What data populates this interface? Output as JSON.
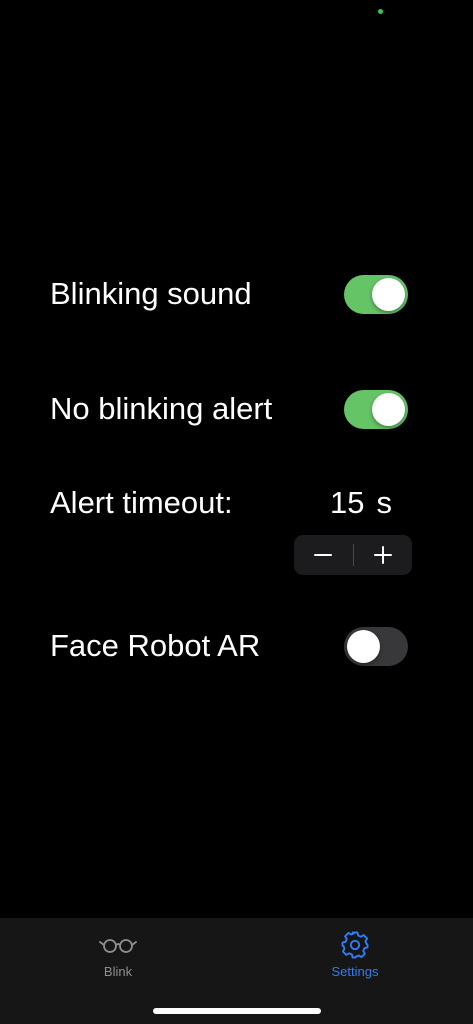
{
  "settings": {
    "blinking_sound": {
      "label": "Blinking sound",
      "enabled": true
    },
    "no_blinking_alert": {
      "label": "No blinking alert",
      "enabled": true
    },
    "alert_timeout": {
      "label": "Alert timeout:",
      "value": "15",
      "unit": "s"
    },
    "face_robot_ar": {
      "label": "Face Robot AR",
      "enabled": false
    }
  },
  "tab_bar": {
    "tabs": [
      {
        "label": "Blink",
        "icon": "glasses-icon",
        "selected": false
      },
      {
        "label": "Settings",
        "icon": "gear-icon",
        "selected": true
      }
    ]
  },
  "colors": {
    "background": "#000000",
    "toggle_on": "#65c466",
    "toggle_off": "#38383a",
    "accent": "#2f7cf6",
    "inactive_tab": "#8e8e93"
  }
}
